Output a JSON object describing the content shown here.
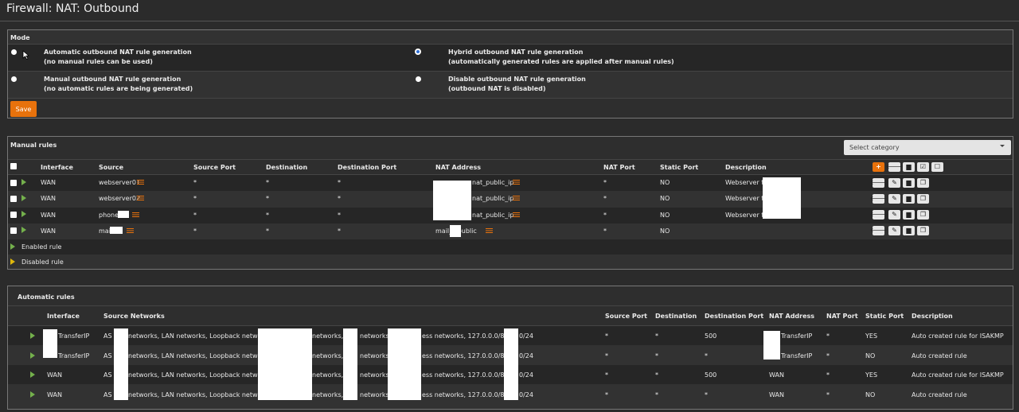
{
  "page": {
    "title": "Firewall: NAT: Outbound"
  },
  "mode": {
    "heading": "Mode",
    "options": [
      {
        "label": "Automatic outbound NAT rule generation",
        "desc": "(no manual rules can be used)",
        "checked": false
      },
      {
        "label": "Hybrid outbound NAT rule generation",
        "desc": "(automatically generated rules are applied after manual rules)",
        "checked": true
      },
      {
        "label": "Manual outbound NAT rule generation",
        "desc": "(no automatic rules are being generated)",
        "checked": false
      },
      {
        "label": "Disable outbound NAT rule generation",
        "desc": "(outbound NAT is disabled)",
        "checked": false
      }
    ],
    "save_label": "Save"
  },
  "manual": {
    "heading": "Manual rules",
    "category_placeholder": "Select category",
    "columns": [
      "Interface",
      "Source",
      "Source Port",
      "Destination",
      "Destination Port",
      "NAT Address",
      "NAT Port",
      "Static Port",
      "Description"
    ],
    "rows": [
      {
        "interface": "WAN",
        "source": "webserver01",
        "source_port": "*",
        "destination": "*",
        "destination_port": "*",
        "nat_address": "nat_public_ip",
        "nat_port": "*",
        "static_port": "NO",
        "description": "Webserver to"
      },
      {
        "interface": "WAN",
        "source": "webserver02",
        "source_port": "*",
        "destination": "*",
        "destination_port": "*",
        "nat_address": "nat_public_ip",
        "nat_port": "*",
        "static_port": "NO",
        "description": "Webserver to"
      },
      {
        "interface": "WAN",
        "source": "phone",
        "source_port": "*",
        "destination": "*",
        "destination_port": "*",
        "nat_address": "nat_public_ip",
        "nat_port": "*",
        "static_port": "NO",
        "description": "Webserver to"
      },
      {
        "interface": "WAN",
        "source": "mai",
        "source_port": "*",
        "destination": "*",
        "destination_port": "*",
        "nat_address": "mail_  _public",
        "nat_port": "*",
        "static_port": "NO",
        "description": ""
      }
    ],
    "legend": {
      "enabled": "Enabled rule",
      "disabled": "Disabled rule"
    },
    "icons": {
      "add": "plus-icon",
      "move": "arrow-left-icon",
      "delete": "trash-icon",
      "edit": "pencil-icon",
      "clone": "copy-icon",
      "enable": "check-square-icon",
      "toggle": "square-icon"
    }
  },
  "automatic": {
    "heading": "Automatic rules",
    "columns": [
      "Interface",
      "Source Networks",
      "Source Port",
      "Destination",
      "Destination Port",
      "NAT Address",
      "NAT Port",
      "Static Port",
      "Description"
    ],
    "rows": [
      {
        "interface": "TransferIP",
        "src_a": "AS",
        "src_b": "networks, LAN networks, Loopback networks,",
        "src_c": "networks, (",
        "src_d": "networks,",
        "src_e": "ess networks, 127.0.0.0/8, 10.",
        "src_f": "0/24",
        "source_port": "*",
        "destination": "*",
        "destination_port": "500",
        "nat_address": "TransferIP",
        "nat_port": "*",
        "static_port": "YES",
        "description": "Auto created rule for ISAKMP"
      },
      {
        "interface": "TransferIP",
        "src_a": "AS",
        "src_b": "networks, LAN networks, Loopback networks,",
        "src_c": "networks, (",
        "src_d": "networks,",
        "src_e": "ess networks, 127.0.0.0/8, 10.",
        "src_f": "0/24",
        "source_port": "*",
        "destination": "*",
        "destination_port": "*",
        "nat_address": "TransferIP",
        "nat_port": "*",
        "static_port": "NO",
        "description": "Auto created rule"
      },
      {
        "interface": "WAN",
        "src_a": "AS",
        "src_b": "networks, LAN networks, Loopback networks,",
        "src_c": "networks, (",
        "src_d": "networks,",
        "src_e": "ess networks, 127.0.0.0/8, 10.",
        "src_f": "0/24",
        "source_port": "*",
        "destination": "*",
        "destination_port": "500",
        "nat_address": "WAN",
        "nat_port": "*",
        "static_port": "YES",
        "description": "Auto created rule for ISAKMP"
      },
      {
        "interface": "WAN",
        "src_a": "AS",
        "src_b": "networks, LAN networks, Loopback networks,",
        "src_c": "networks, (",
        "src_d": "networks,",
        "src_e": "ess networks, 127.0.0.0/8, 10.",
        "src_f": "0/24",
        "source_port": "*",
        "destination": "*",
        "destination_port": "*",
        "nat_address": "WAN",
        "nat_port": "*",
        "static_port": "NO",
        "description": "Auto created rule"
      }
    ]
  },
  "colors": {
    "accent": "#e8720c",
    "enabled": "#74b04c",
    "disabled": "#e0b80c",
    "radio_selected": "#2f6fd6"
  }
}
